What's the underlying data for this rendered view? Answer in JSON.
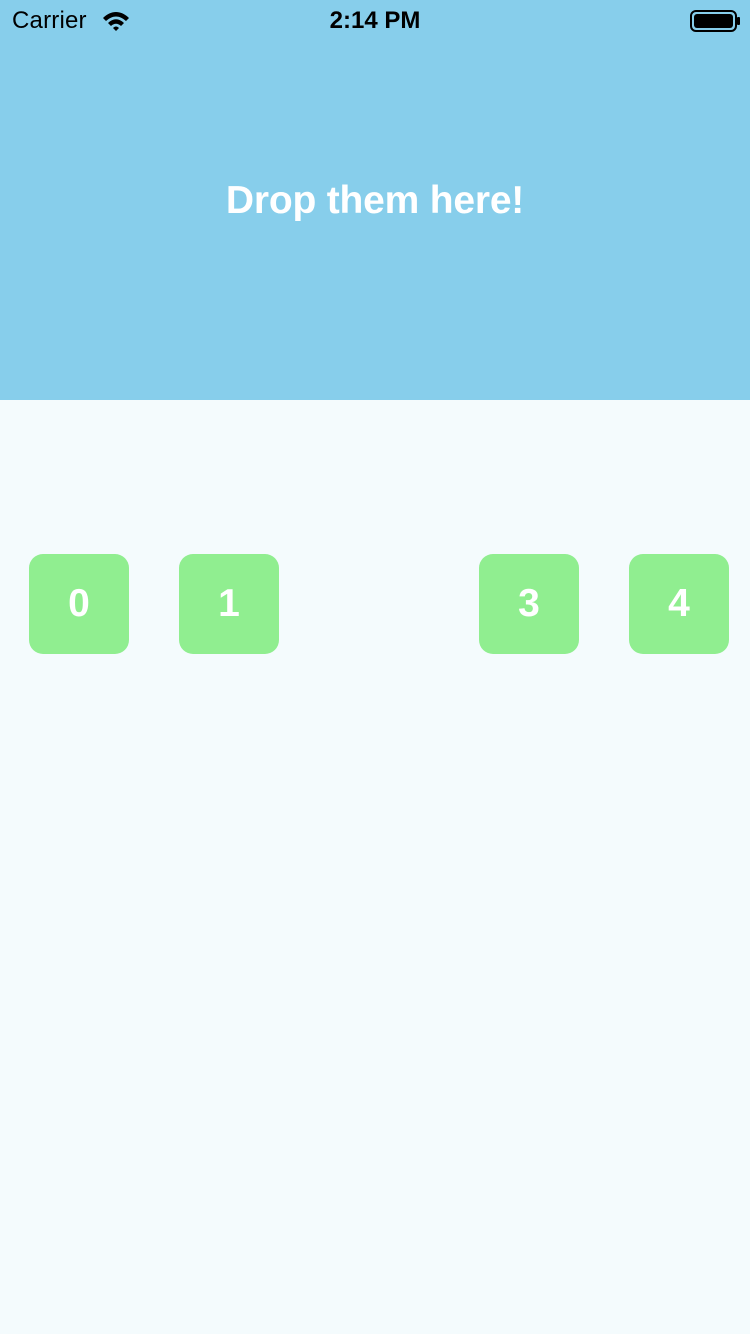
{
  "status_bar": {
    "carrier": "Carrier",
    "time": "2:14 PM",
    "wifi_icon": "wifi-icon",
    "battery_icon": "battery-icon"
  },
  "drop_zone": {
    "title": "Drop them here!",
    "background": "#87ceeb"
  },
  "tiles": [
    {
      "label": "0",
      "color": "#90ee90"
    },
    {
      "label": "1",
      "color": "#90ee90"
    },
    {
      "label": "3",
      "color": "#90ee90"
    },
    {
      "label": "4",
      "color": "#90ee90"
    }
  ],
  "colors": {
    "page_background": "#f4fbfd",
    "tile_text": "#ffffff"
  }
}
